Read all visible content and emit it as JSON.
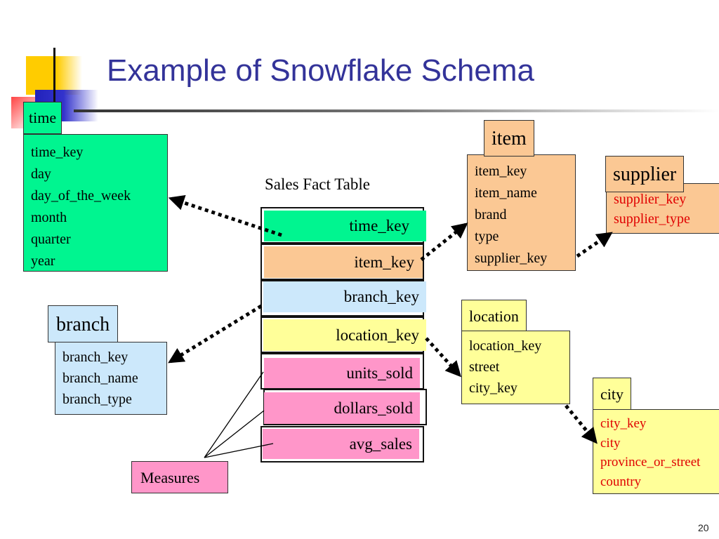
{
  "slide": {
    "title": "Example of Snowflake Schema",
    "page_number": "20"
  },
  "fact_table": {
    "label": "Sales Fact Table",
    "fields": [
      "time_key",
      "item_key",
      "branch_key",
      "location_key",
      "units_sold",
      "dollars_sold",
      "avg_sales"
    ]
  },
  "tables": {
    "time": {
      "name": "time",
      "attributes": [
        "time_key",
        "day",
        "day_of_the_week",
        "month",
        "quarter",
        "year"
      ]
    },
    "item": {
      "name": "item",
      "attributes": [
        "item_key",
        "item_name",
        "brand",
        "type",
        "supplier_key"
      ]
    },
    "supplier": {
      "name": "supplier",
      "attributes": [
        "supplier_key",
        "supplier_type"
      ]
    },
    "branch": {
      "name": "branch",
      "attributes": [
        "branch_key",
        "branch_name",
        "branch_type"
      ]
    },
    "location": {
      "name": "location",
      "attributes": [
        "location_key",
        "street",
        "city_key"
      ]
    },
    "city": {
      "name": "city",
      "attributes": [
        "city_key",
        "city",
        "province_or_street",
        "country"
      ]
    }
  },
  "measures_label": "Measures",
  "colors": {
    "title": "#333399",
    "time": "#00f590",
    "item": "#fbc894",
    "branch": "#cce8fb",
    "location": "#ffff99",
    "measures": "#ff96c9",
    "snowflake_attribute_text": "#e00000"
  }
}
